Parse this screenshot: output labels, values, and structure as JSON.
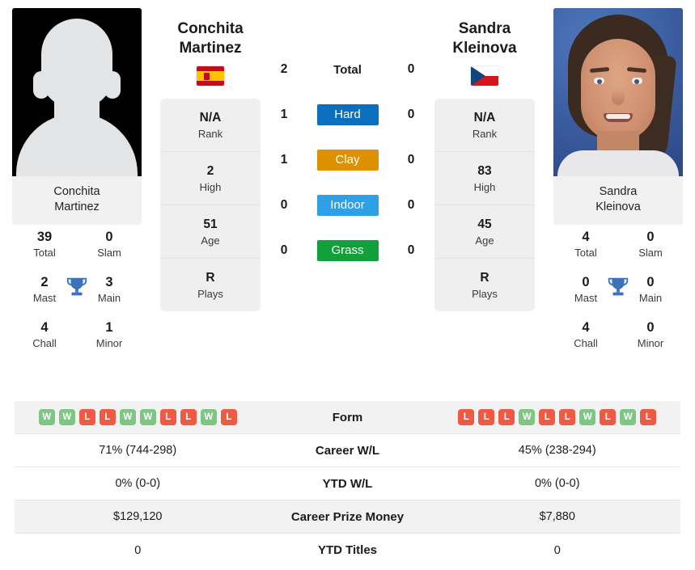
{
  "players": {
    "left": {
      "first_name": "Conchita",
      "last_name": "Martinez",
      "full_name_line1": "Conchita",
      "full_name_line2": "Martinez",
      "caption_line1": "Conchita",
      "caption_line2": "Martinez",
      "flag": "spain-flag",
      "titles": [
        {
          "value": "39",
          "label": "Total"
        },
        {
          "value": "0",
          "label": "Slam"
        },
        {
          "value": "2",
          "label": "Mast"
        },
        {
          "value": "3",
          "label": "Main"
        },
        {
          "value": "4",
          "label": "Chall"
        },
        {
          "value": "1",
          "label": "Minor"
        }
      ],
      "info": [
        {
          "value": "N/A",
          "label": "Rank"
        },
        {
          "value": "2",
          "label": "High"
        },
        {
          "value": "51",
          "label": "Age"
        },
        {
          "value": "R",
          "label": "Plays"
        }
      ],
      "form": [
        "W",
        "W",
        "L",
        "L",
        "W",
        "W",
        "L",
        "L",
        "W",
        "L"
      ],
      "career_wl": "71% (744-298)",
      "ytd_wl": "0% (0-0)",
      "career_prize_money": "$129,120",
      "ytd_titles": "0"
    },
    "right": {
      "first_name": "Sandra",
      "last_name": "Kleinova",
      "full_name_line1": "Sandra",
      "full_name_line2": "Kleinova",
      "caption_line1": "Sandra",
      "caption_line2": "Kleinova",
      "flag": "czech-republic-flag",
      "titles": [
        {
          "value": "4",
          "label": "Total"
        },
        {
          "value": "0",
          "label": "Slam"
        },
        {
          "value": "0",
          "label": "Mast"
        },
        {
          "value": "0",
          "label": "Main"
        },
        {
          "value": "4",
          "label": "Chall"
        },
        {
          "value": "0",
          "label": "Minor"
        }
      ],
      "info": [
        {
          "value": "N/A",
          "label": "Rank"
        },
        {
          "value": "83",
          "label": "High"
        },
        {
          "value": "45",
          "label": "Age"
        },
        {
          "value": "R",
          "label": "Plays"
        }
      ],
      "form": [
        "L",
        "L",
        "L",
        "W",
        "L",
        "L",
        "W",
        "L",
        "W",
        "L"
      ],
      "career_wl": "45% (238-294)",
      "ytd_wl": "0% (0-0)",
      "career_prize_money": "$7,880",
      "ytd_titles": "0"
    }
  },
  "head_to_head": [
    {
      "label": "Total",
      "left": "2",
      "right": "0",
      "badge": false,
      "color": ""
    },
    {
      "label": "Hard",
      "left": "1",
      "right": "0",
      "badge": true,
      "color": "#0b6fc0"
    },
    {
      "label": "Clay",
      "left": "1",
      "right": "0",
      "badge": true,
      "color": "#dd9000"
    },
    {
      "label": "Indoor",
      "left": "0",
      "right": "0",
      "badge": true,
      "color": "#2f9fe8"
    },
    {
      "label": "Grass",
      "left": "0",
      "right": "0",
      "badge": true,
      "color": "#12a03a"
    }
  ],
  "comparison_rows": [
    {
      "label": "Form"
    },
    {
      "label": "Career W/L"
    },
    {
      "label": "YTD W/L"
    },
    {
      "label": "Career Prize Money"
    },
    {
      "label": "YTD Titles"
    }
  ],
  "colors": {
    "win_badge": "#7ec684",
    "loss_badge": "#ef5a45",
    "trophy": "#3c72b9",
    "card_bg": "#efefef",
    "row_shade": "#f2f2f2"
  }
}
